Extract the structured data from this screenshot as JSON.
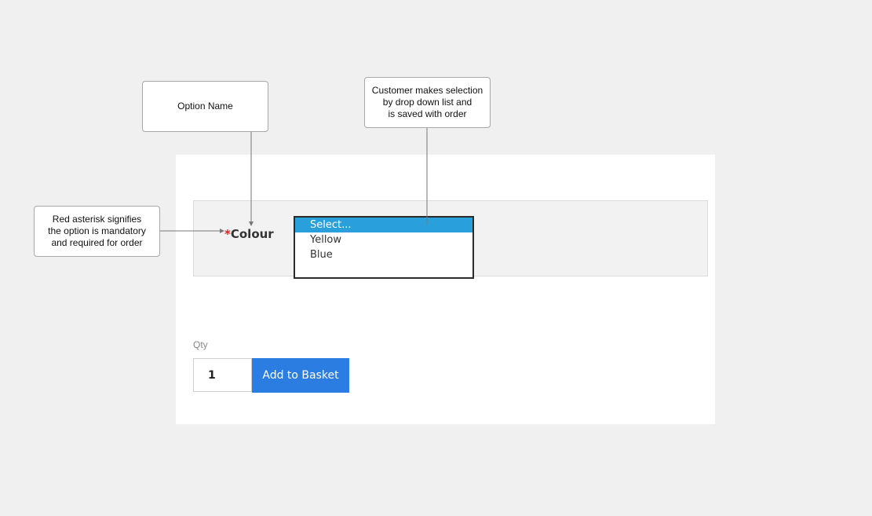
{
  "annotations": {
    "option_name": {
      "lines": [
        "Option Name"
      ]
    },
    "dropdown_note": {
      "lines": [
        "Customer makes selection",
        "by drop down list and",
        "is saved with order"
      ]
    },
    "asterisk_note": {
      "lines": [
        "Red asterisk signifies",
        "the option is mandatory",
        "and required for order"
      ]
    }
  },
  "product_option": {
    "required_marker": "*",
    "name": "Colour",
    "options": [
      "Select...",
      "Yellow",
      "Blue"
    ],
    "selected_index": 0
  },
  "purchase": {
    "qty_label": "Qty",
    "qty_value": "1",
    "add_button_label": "Add to Basket"
  },
  "colors": {
    "required_marker": "#e0201b",
    "selected_option_bg": "#29a0dc",
    "button_bg": "#2b7de1"
  }
}
